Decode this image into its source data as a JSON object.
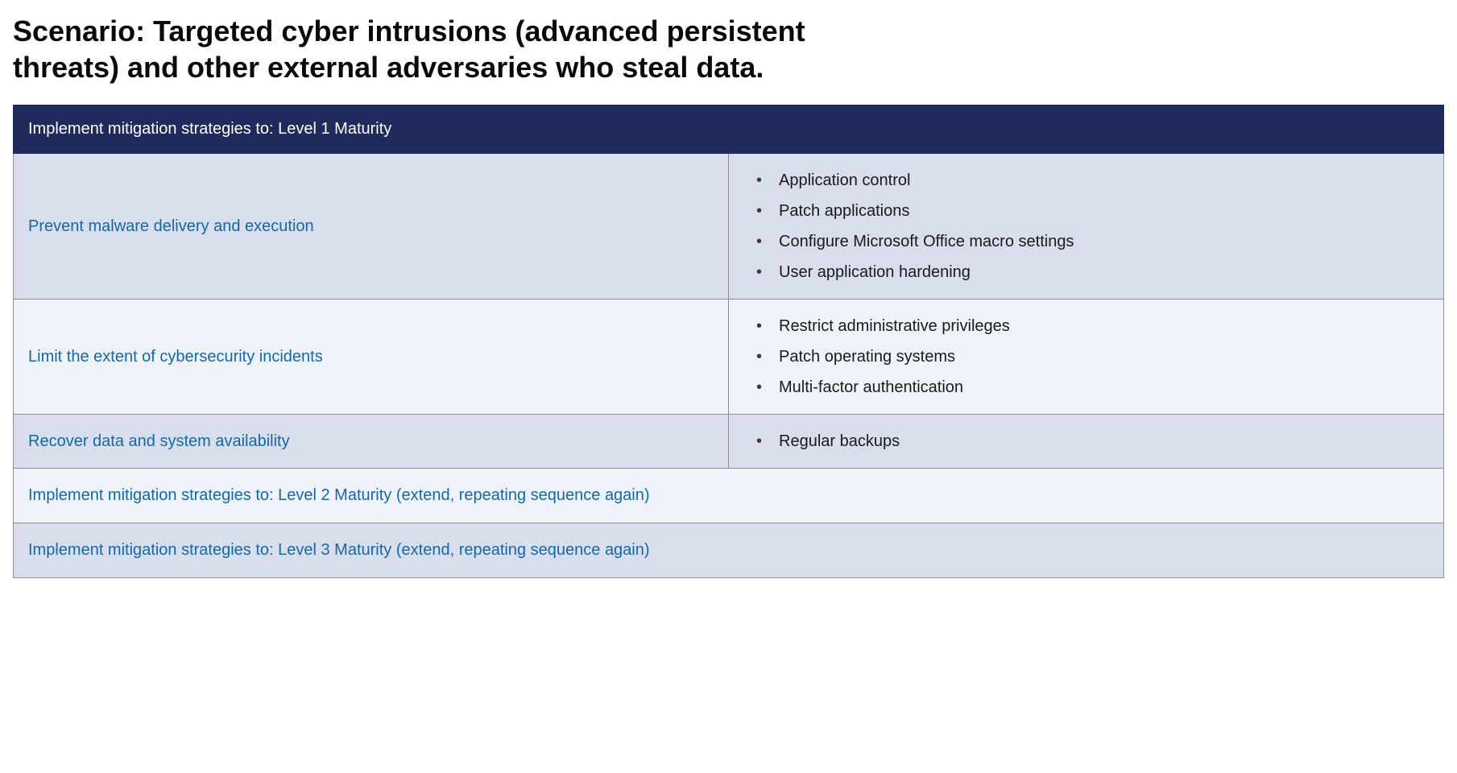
{
  "title": "Scenario: Targeted cyber intrusions (advanced persistent threats) and other external adversaries who steal data.",
  "table": {
    "header": "Implement mitigation strategies to: Level 1 Maturity",
    "rows": [
      {
        "category": "Prevent malware delivery and execution",
        "items": [
          "Application control",
          "Patch applications",
          "Configure Microsoft Office macro settings",
          "User application hardening"
        ]
      },
      {
        "category": "Limit the extent of cybersecurity incidents",
        "items": [
          "Restrict administrative privileges",
          "Patch operating systems",
          "Multi-factor authentication"
        ]
      },
      {
        "category": "Recover data and system availability",
        "items": [
          "Regular backups"
        ]
      }
    ],
    "footerLinks": [
      "Implement mitigation strategies to: Level 2 Maturity (extend, repeating sequence again)",
      "Implement mitigation strategies to: Level 3 Maturity (extend, repeating sequence again)"
    ]
  }
}
